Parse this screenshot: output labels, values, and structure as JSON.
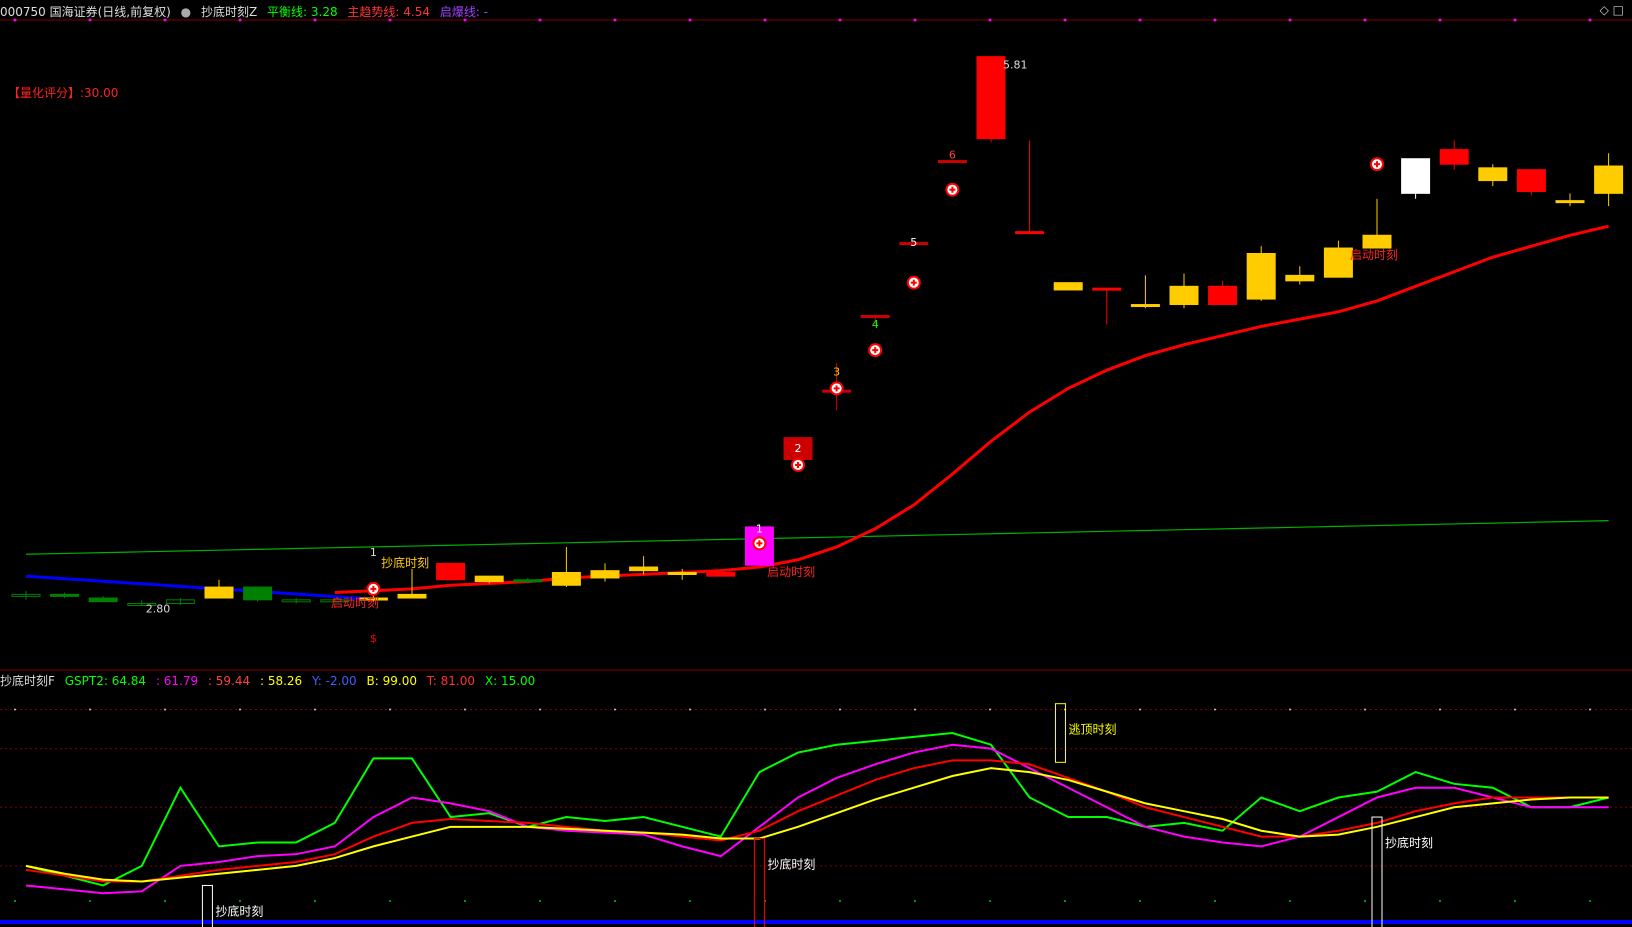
{
  "header": {
    "title": "000750 国海证券(日线,前复权)",
    "indicator_name": "抄底时刻Z",
    "balance_label": "平衡线: 3.28",
    "trend_label": "主趋势线: 4.54",
    "burst_label": "启爆线: -",
    "score_label": "【量化评分】:30.00",
    "icons": [
      "diamond-icon",
      "maximize-icon"
    ]
  },
  "sub_header": {
    "indicator_name": "抄底时刻F",
    "gspt2_label": "GSPT2: 64.84",
    "v2_label": ": 61.79",
    "v3_label": ": 59.44",
    "v4_label": ": 58.26",
    "y_label": "Y: -2.00",
    "b_label": "B: 99.00",
    "t_label": "T: 81.00",
    "x_label": "X: 15.00"
  },
  "colors": {
    "background": "#000000",
    "up_red": "#ff0000",
    "dark_red": "#cc0000",
    "gold": "#ffcc00",
    "green_candle": "#008000",
    "magenta": "#ff00ff",
    "green_line": "#00cc00",
    "trend_red": "#ff0000",
    "blue": "#0000ff",
    "yellow": "#ffff00"
  },
  "chart_data": [
    {
      "type": "candlestick",
      "title": "000750 国海证券(日线,前复权)",
      "ylim": [
        2.5,
        6.0
      ],
      "annotations": {
        "high_label": "5.81",
        "low_label": "2.80",
        "markers": [
          "1",
          "2",
          "3",
          "4",
          "5",
          "6",
          "1",
          "$"
        ],
        "signals": [
          "抄底时刻",
          "启动时刻",
          "启动时刻",
          "启动时刻"
        ]
      },
      "candles": [
        {
          "o": 2.86,
          "h": 2.88,
          "c": 2.86,
          "l": 2.83,
          "color": "green_hollow"
        },
        {
          "o": 2.86,
          "h": 2.87,
          "c": 2.85,
          "l": 2.84,
          "color": "green"
        },
        {
          "o": 2.84,
          "h": 2.85,
          "c": 2.82,
          "l": 2.82,
          "color": "green"
        },
        {
          "o": 2.81,
          "h": 2.83,
          "c": 2.81,
          "l": 2.8,
          "color": "green_hollow"
        },
        {
          "o": 2.81,
          "h": 2.84,
          "c": 2.83,
          "l": 2.8,
          "color": "green_hollow"
        },
        {
          "o": 2.84,
          "h": 2.94,
          "c": 2.9,
          "l": 2.84,
          "color": "gold"
        },
        {
          "o": 2.9,
          "h": 2.9,
          "c": 2.83,
          "l": 2.82,
          "color": "green"
        },
        {
          "o": 2.83,
          "h": 2.84,
          "c": 2.82,
          "l": 2.81,
          "color": "green_hollow"
        },
        {
          "o": 2.82,
          "h": 2.84,
          "c": 2.83,
          "l": 2.82,
          "color": "green_hollow"
        },
        {
          "o": 2.83,
          "h": 2.86,
          "c": 2.84,
          "l": 2.82,
          "color": "gold"
        },
        {
          "o": 2.84,
          "h": 3.0,
          "c": 2.86,
          "l": 2.84,
          "color": "gold"
        },
        {
          "o": 2.94,
          "h": 2.98,
          "c": 3.03,
          "l": 2.95,
          "color": "red"
        },
        {
          "o": 2.93,
          "h": 2.96,
          "c": 2.96,
          "l": 2.92,
          "color": "gold"
        },
        {
          "o": 2.93,
          "h": 2.95,
          "c": 2.94,
          "l": 2.92,
          "color": "green"
        },
        {
          "o": 2.91,
          "h": 3.12,
          "c": 2.98,
          "l": 2.9,
          "color": "gold"
        },
        {
          "o": 2.95,
          "h": 3.03,
          "c": 2.99,
          "l": 2.93,
          "color": "gold"
        },
        {
          "o": 2.99,
          "h": 3.07,
          "c": 3.01,
          "l": 2.97,
          "color": "gold"
        },
        {
          "o": 2.97,
          "h": 3.0,
          "c": 2.98,
          "l": 2.94,
          "color": "gold"
        },
        {
          "o": 2.96,
          "h": 2.99,
          "c": 2.98,
          "l": 2.96,
          "color": "red"
        },
        {
          "o": 3.02,
          "h": 3.23,
          "c": 3.23,
          "l": 3.02,
          "color": "magenta"
        },
        {
          "o": 3.72,
          "h": 3.72,
          "c": 3.6,
          "l": 3.59,
          "color": "dark_red"
        },
        {
          "o": 3.98,
          "h": 4.13,
          "c": 3.98,
          "l": 3.87,
          "color": "dark_red"
        },
        {
          "o": 4.39,
          "h": 4.31,
          "c": 4.38,
          "l": 4.34,
          "color": "dark_red"
        },
        {
          "o": 4.79,
          "h": 4.72,
          "c": 4.79,
          "l": 4.79,
          "color": "dark_red"
        },
        {
          "o": 5.24,
          "h": 5.16,
          "c": 5.24,
          "l": 5.24,
          "color": "dark_red"
        },
        {
          "o": 5.81,
          "h": 5.81,
          "c": 5.36,
          "l": 5.34,
          "color": "red"
        },
        {
          "o": 4.85,
          "h": 5.35,
          "c": 4.85,
          "l": 4.85,
          "color": "red"
        },
        {
          "o": 4.57,
          "h": 4.48,
          "c": 4.53,
          "l": 4.53,
          "color": "gold"
        },
        {
          "o": 4.54,
          "h": 4.54,
          "c": 4.54,
          "l": 4.34,
          "color": "red"
        },
        {
          "o": 4.45,
          "h": 4.61,
          "c": 4.45,
          "l": 4.43,
          "color": "gold"
        },
        {
          "o": 4.45,
          "h": 4.62,
          "c": 4.55,
          "l": 4.43,
          "color": "gold"
        },
        {
          "o": 4.55,
          "h": 4.58,
          "c": 4.45,
          "l": 4.47,
          "color": "red"
        },
        {
          "o": 4.48,
          "h": 4.77,
          "c": 4.73,
          "l": 4.47,
          "color": "gold"
        },
        {
          "o": 4.58,
          "h": 4.66,
          "c": 4.61,
          "l": 4.56,
          "color": "gold"
        },
        {
          "o": 4.6,
          "h": 4.8,
          "c": 4.76,
          "l": 4.6,
          "color": "gold"
        },
        {
          "o": 4.76,
          "h": 5.03,
          "c": 4.83,
          "l": 4.76,
          "color": "gold"
        },
        {
          "o": 5.06,
          "h": 5.25,
          "c": 5.25,
          "l": 5.03,
          "color": "white"
        },
        {
          "o": 5.3,
          "h": 5.35,
          "c": 5.22,
          "l": 5.19,
          "color": "red"
        },
        {
          "o": 5.2,
          "h": 5.22,
          "c": 5.13,
          "l": 5.1,
          "color": "gold"
        },
        {
          "o": 5.19,
          "h": 5.19,
          "c": 5.07,
          "l": 5.05,
          "color": "red"
        },
        {
          "o": 5.02,
          "h": 5.06,
          "c": 5.02,
          "l": 4.99,
          "color": "gold"
        },
        {
          "o": 5.06,
          "h": 5.28,
          "c": 5.21,
          "l": 4.99,
          "color": "gold"
        }
      ]
    },
    {
      "type": "line",
      "title": "抄底时刻F",
      "ylim": [
        0,
        110
      ],
      "series": [
        {
          "name": "GSPT2",
          "color": "green_line",
          "values": [
            20,
            15,
            10,
            20,
            60,
            30,
            32,
            32,
            42,
            75,
            75,
            45,
            47,
            40,
            45,
            43,
            45,
            40,
            35,
            68,
            78,
            82,
            84,
            86,
            88,
            82,
            55,
            45,
            45,
            40,
            42,
            38,
            55,
            48,
            55,
            58,
            68,
            62,
            60,
            50,
            50,
            55
          ]
        },
        {
          "name": "",
          "color": "magenta",
          "values": [
            10,
            8,
            6,
            7,
            20,
            22,
            25,
            26,
            30,
            45,
            55,
            52,
            48,
            40,
            38,
            37,
            36,
            30,
            25,
            40,
            55,
            65,
            72,
            78,
            82,
            80,
            70,
            60,
            50,
            40,
            35,
            32,
            30,
            35,
            45,
            55,
            60,
            60,
            55,
            50,
            50,
            50
          ]
        },
        {
          "name": "",
          "color": "trend_red",
          "values": [
            18,
            15,
            12,
            12,
            15,
            18,
            20,
            22,
            26,
            35,
            42,
            44,
            43,
            42,
            40,
            38,
            37,
            35,
            33,
            38,
            48,
            56,
            64,
            70,
            74,
            74,
            72,
            65,
            58,
            50,
            45,
            40,
            35,
            35,
            38,
            42,
            48,
            52,
            55,
            55,
            55,
            55
          ]
        },
        {
          "name": "",
          "color": "yellow",
          "values": [
            20,
            16,
            13,
            12,
            14,
            16,
            18,
            20,
            24,
            30,
            35,
            40,
            40,
            40,
            39,
            38,
            37,
            36,
            34,
            34,
            40,
            47,
            54,
            60,
            66,
            70,
            68,
            64,
            58,
            52,
            48,
            44,
            38,
            35,
            36,
            40,
            45,
            50,
            52,
            54,
            55,
            55
          ]
        }
      ],
      "annotations": [
        "抄底时刻",
        "抄底时刻",
        "抄底时刻",
        "逃顶时刻"
      ]
    }
  ]
}
